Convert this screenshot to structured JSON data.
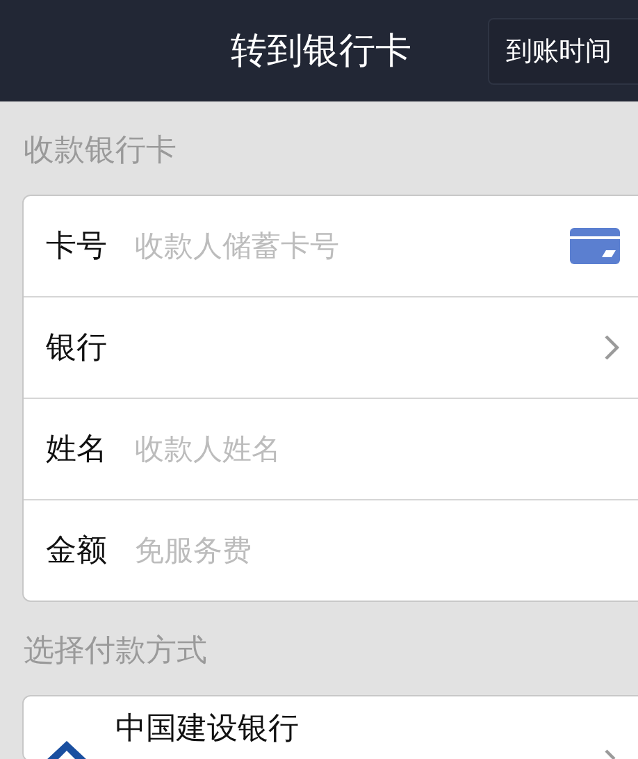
{
  "header": {
    "title": "转到银行卡",
    "action": "到账时间"
  },
  "sections": [
    {
      "label": "收款银行卡",
      "rows": [
        {
          "kind": "card-input",
          "label": "卡号",
          "placeholder": "收款人储蓄卡号"
        },
        {
          "kind": "select",
          "label": "银行"
        },
        {
          "kind": "input",
          "label": "姓名",
          "placeholder": "收款人姓名"
        },
        {
          "kind": "input",
          "label": "金额",
          "placeholder": "免服务费"
        }
      ]
    },
    {
      "label": "选择付款方式",
      "rows": [
        {
          "kind": "bank",
          "label": "中国建设银行"
        }
      ]
    }
  ]
}
